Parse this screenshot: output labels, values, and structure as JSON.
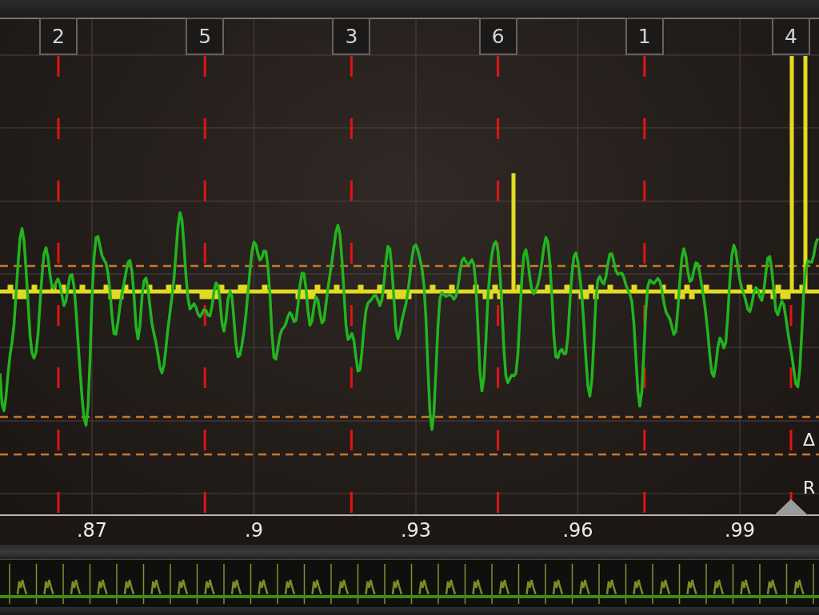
{
  "plot": {
    "markers": [
      {
        "label": "2"
      },
      {
        "label": "5"
      },
      {
        "label": "3"
      },
      {
        "label": "6"
      },
      {
        "label": "1"
      },
      {
        "label": "4"
      }
    ],
    "side_labels": [
      "Δ",
      "R"
    ]
  },
  "x_axis": {
    "tick_labels": [
      ".87",
      ".9",
      ".93",
      ".96",
      ".99"
    ]
  }
}
